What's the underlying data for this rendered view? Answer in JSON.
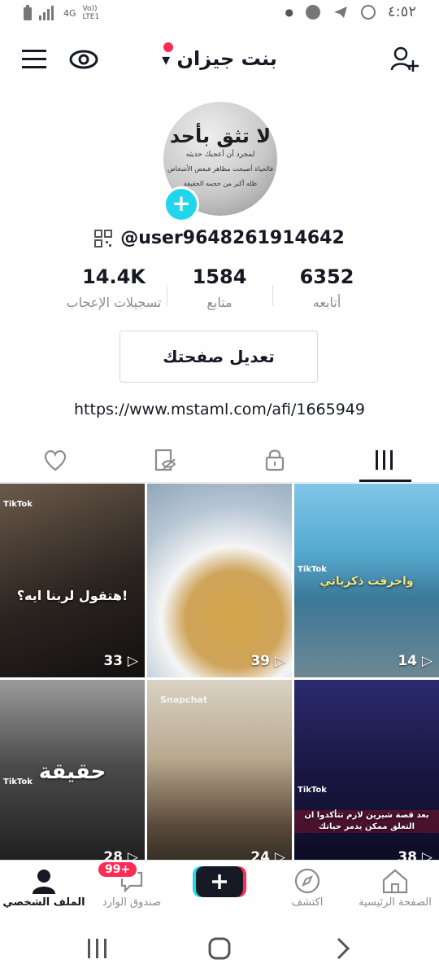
{
  "status_bar": {
    "network": "4G",
    "volte": "Vo)) LTE1",
    "time": "٤:٥٢"
  },
  "header": {
    "title": "بنت جيزان"
  },
  "profile": {
    "avatar_text": [
      "لا تثق بأحد",
      "لمجرد أن أعجبك حديثه",
      "فالحياة أصبحت مظاهر فبعض الأشخاص",
      "ظله أكبر من حجمه الحقيقة"
    ],
    "handle": "@user9648261914642"
  },
  "stats": [
    {
      "value": "14.4K",
      "label": "تسجيلات الإعجاب"
    },
    {
      "value": "1584",
      "label": "متابع"
    },
    {
      "value": "6352",
      "label": "أتابعه"
    }
  ],
  "edit_profile_label": "تعديل صفحتك",
  "bio_link": "https://www.mstaml.com/afi/1665949",
  "videos": [
    {
      "views": "33",
      "caption": "هتقول لربنا ايه؟!",
      "tag": "TikTok"
    },
    {
      "views": "39",
      "caption": "",
      "tag": ""
    },
    {
      "views": "14",
      "caption": "واحرقت ذكرياتي",
      "tag": "TikTok"
    },
    {
      "views": "28",
      "caption": "حقيقة",
      "tag": "TikTok"
    },
    {
      "views": "24",
      "caption": "",
      "tag": "Snapchat"
    },
    {
      "views": "38",
      "caption": "بعد قصة شيرين لازم تتأكدوا ان التعلق ممكن يدمر حياتك",
      "tag": "TikTok"
    }
  ],
  "bottom_nav": {
    "home": "الصفحة الرئيسية",
    "discover": "اكتشف",
    "inbox": "صندوق الوارد",
    "inbox_badge": "99+",
    "profile": "الملف الشخصي"
  }
}
